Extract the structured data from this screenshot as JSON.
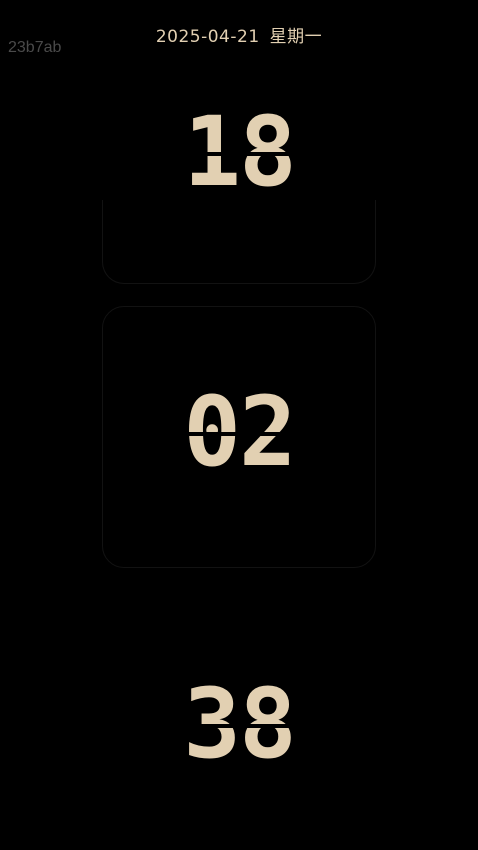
{
  "status": {
    "date": "2025-04-21",
    "weekday": "星期一",
    "build_id": "23b7ab"
  },
  "clock": {
    "hours": "18",
    "minutes": "02",
    "seconds": "38"
  },
  "colors": {
    "background": "#000000",
    "digit": "#e2d0b2",
    "build_id": "#4a4a4a"
  }
}
